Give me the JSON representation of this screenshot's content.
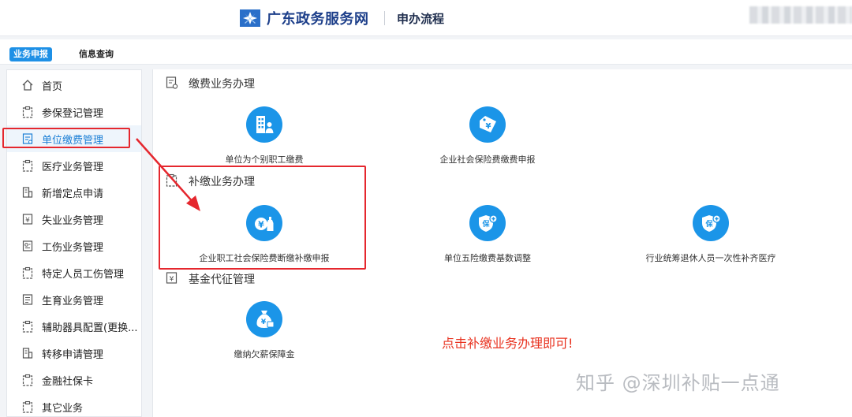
{
  "header": {
    "site_title": "广东政务服务网",
    "sub_title": "申办流程"
  },
  "tabs": {
    "active": "业务申报",
    "other": "信息查询"
  },
  "sidebar": {
    "items": [
      {
        "label": "首页",
        "icon": "home-icon"
      },
      {
        "label": "参保登记管理",
        "icon": "clipboard-icon"
      },
      {
        "label": "单位缴费管理",
        "icon": "invoice-icon"
      },
      {
        "label": "医疗业务管理",
        "icon": "clipboard-icon"
      },
      {
        "label": "新增定点申请",
        "icon": "building-icon"
      },
      {
        "label": "失业业务管理",
        "icon": "yuan-doc-icon"
      },
      {
        "label": "工伤业务管理",
        "icon": "id-card-icon"
      },
      {
        "label": "特定人员工伤管理",
        "icon": "clipboard-icon"
      },
      {
        "label": "生育业务管理",
        "icon": "doc-icon"
      },
      {
        "label": "辅助器具配置(更换...",
        "icon": "clipboard-icon"
      },
      {
        "label": "转移申请管理",
        "icon": "building-icon"
      },
      {
        "label": "金融社保卡",
        "icon": "clipboard-icon"
      },
      {
        "label": "其它业务",
        "icon": "clipboard-icon"
      }
    ],
    "active_index": 2
  },
  "main": {
    "sections": [
      {
        "title": "缴费业务办理",
        "icon": "invoice-gear-icon"
      },
      {
        "title": "补缴业务办理",
        "icon": "clipboard-icon"
      },
      {
        "title": "基金代征管理",
        "icon": "yuan-doc-icon"
      }
    ],
    "cards": [
      {
        "label": "单位为个别职工缴费",
        "icon": "building-person-icon"
      },
      {
        "label": "企业社会保险费缴费申报",
        "icon": "yuan-tag-icon"
      },
      {
        "label": "企业职工社会保险费断缴补缴申报",
        "icon": "yuan-bottle-icon"
      },
      {
        "label": "单位五险缴费基数调整",
        "icon": "shield-plus-icon"
      },
      {
        "label": "行业统筹退休人员一次性补齐医疗",
        "icon": "shield-plus-icon"
      },
      {
        "label": "缴纳欠薪保障金",
        "icon": "money-bag-icon"
      }
    ],
    "shield_text": "保",
    "yuan_text": "¥",
    "hint": "点击补缴业务办理即可!",
    "watermark": "知乎 @深圳补贴一点通"
  },
  "colors": {
    "brand_blue": "#1b95e8",
    "annotation_red": "#e5272e",
    "hint_red": "#e8321f",
    "title_navy": "#1d3f8a"
  }
}
